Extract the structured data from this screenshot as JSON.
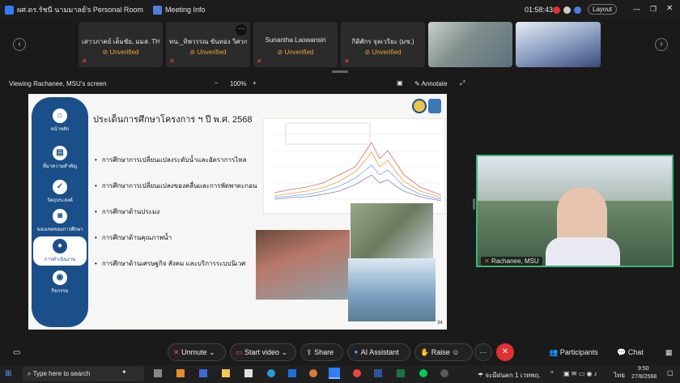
{
  "titlebar": {
    "room_title": "ผศ.ดร.รัชนี นามมาลย์'s Personal Room",
    "meeting_info": "Meeting Info",
    "time": "01:58:43",
    "layout_label": "Layout"
  },
  "participants": [
    {
      "name": "เสาวภาคย์ เต็มชัย, มมส. TH",
      "status": "Unverified"
    },
    {
      "name": "ทน._ทิพวรรณ ขันทอง วิศวก...",
      "status": "Unverified"
    },
    {
      "name": "Sunantha Laowansiri",
      "status": "Unverified"
    },
    {
      "name": "กิติศักร จุลเวริยะ (มซ.)",
      "status": "Unverified"
    }
  ],
  "viewbar": {
    "label": "Viewing Rachanee, MSU's screen",
    "zoom": "100%",
    "minus": "−",
    "plus": "+",
    "annotate": "Annotate"
  },
  "slide": {
    "title": "ประเด็นการศึกษาโครงการ ฯ ปี พ.ศ. 2568",
    "bullets": [
      "การศึกษาการเปลี่ยนแปลงระดับน้ำและอัตราการไหล",
      "การศึกษาการเปลี่ยนแปลงของคลื่นและการพัดพาตะกอน",
      "การศึกษาด้านประมง",
      "การศึกษาด้านคุณภาพน้ำ",
      "การศึกษาด้านเศรษฐกิจ สังคม และบริการระบบนิเวศ"
    ],
    "sidebar": [
      {
        "label": "หน้าหลัก",
        "icon": "home-icon",
        "glyph": "⌂"
      },
      {
        "label": "ที่มาความสำคัญ",
        "icon": "id-card-icon",
        "glyph": "▤"
      },
      {
        "label": "วัตถุประสงค์",
        "icon": "check-icon",
        "glyph": "✓"
      },
      {
        "label": "ขอบเขตของการศึกษา",
        "icon": "bag-icon",
        "glyph": "◙"
      },
      {
        "label": "การดำเนินงาน",
        "icon": "person-icon",
        "glyph": "●"
      },
      {
        "label": "กิจกรรม",
        "icon": "group-icon",
        "glyph": "◉"
      }
    ],
    "page_number": "34"
  },
  "speaker": {
    "name": "Rachanee, MSU"
  },
  "controls": {
    "unmute": "Unmute",
    "start_video": "Start video",
    "share": "Share",
    "ai_assistant": "AI Assistant",
    "raise": "Raise",
    "more": "···",
    "participants": "Participants",
    "chat": "Chat"
  },
  "taskbar": {
    "search_placeholder": "Type here to search",
    "weather": "จะมีฝนตก 1 เวทพฤ.",
    "lang": "ไทย",
    "time": "9:50",
    "date": "27/8/2568"
  },
  "colors": {
    "accent_green": "#3fb37a",
    "unverified": "#e8a33a",
    "slide_sidebar": "#1b4f8a",
    "end_red": "#e03131"
  }
}
